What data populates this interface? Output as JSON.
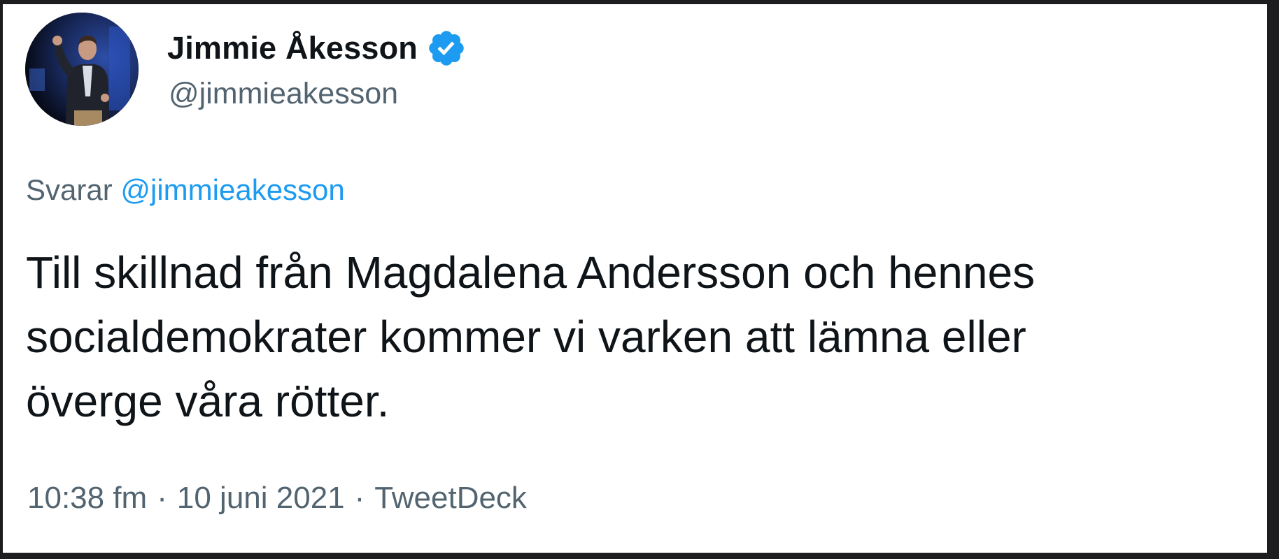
{
  "tweet": {
    "author": {
      "name": "Jimmie Åkesson",
      "handle": "@jimmieakesson",
      "verified": true,
      "avatar_icon": "profile-photo"
    },
    "reply": {
      "prefix": "Svarar",
      "mention": "@jimmieakesson"
    },
    "text_lines": [
      "Till skillnad från Magdalena Andersson och hennes",
      "socialdemokrater kommer vi varken att lämna eller",
      "överge våra rötter."
    ],
    "meta": {
      "time": "10:38 fm",
      "date": "10 juni 2021",
      "separator": "·",
      "source": "TweetDeck"
    }
  },
  "colors": {
    "primary_text": "#0f1419",
    "secondary_text": "#536471",
    "link": "#1d9bf0",
    "verified_badge": "#1d9bf0",
    "background": "#ffffff",
    "frame": "#1d1d1f"
  }
}
